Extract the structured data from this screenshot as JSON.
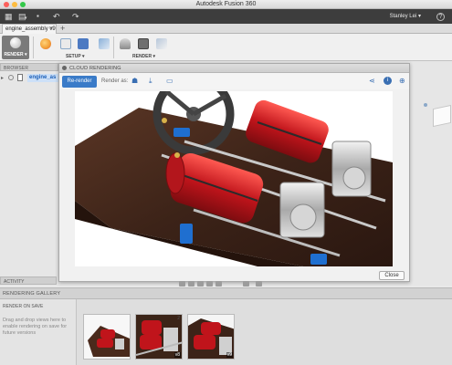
{
  "window": {
    "title": "Autodesk Fusion 360",
    "traffic_colors": [
      "#fc605c",
      "#fdbc40",
      "#34c84a"
    ]
  },
  "quick_access": {
    "icons": [
      "grid-icon",
      "file-icon",
      "save-icon",
      "undo-icon",
      "redo-icon"
    ],
    "user": "Stanley Lei",
    "user_caret": "▾",
    "help": "?"
  },
  "tabs": {
    "document": "engine_assembly v9",
    "close": "×",
    "add": "+"
  },
  "toolbar": {
    "workspace": "RENDER ▾",
    "groups": [
      {
        "label": "SETUP ▾"
      },
      {
        "label": "RENDER ▾"
      }
    ],
    "icon_colors": {
      "appearance": "#f2a23a",
      "environment": "#8ab0d8",
      "decal": "#4c7ac2",
      "rendering": "#6f6f6f"
    }
  },
  "browser": {
    "header": "BROWSER",
    "item": "engine_as",
    "arrow": "▸"
  },
  "dialog": {
    "title": "CLOUD RENDERING",
    "rerender": "Re-render",
    "render_as": "Render as:",
    "close": "Close",
    "icons": [
      "people-icon",
      "download-icon",
      "gallery-icon",
      "share-icon",
      "info-icon",
      "zoom-icon"
    ]
  },
  "activity": {
    "header": "ACTIVITY"
  },
  "gallery": {
    "header": "RENDERING GALLERY",
    "render_on_save": "RENDER ON SAVE",
    "help": "Drag and drop views here to enable rendering on save for future versions",
    "thumbnails": [
      {
        "badge": ""
      },
      {
        "badge": "v8",
        "number": "2"
      },
      {
        "badge": "v9"
      }
    ]
  },
  "colors": {
    "accent": "#3a7bc8",
    "engine_red": "#d71920",
    "wood": "#4a2a1c"
  }
}
